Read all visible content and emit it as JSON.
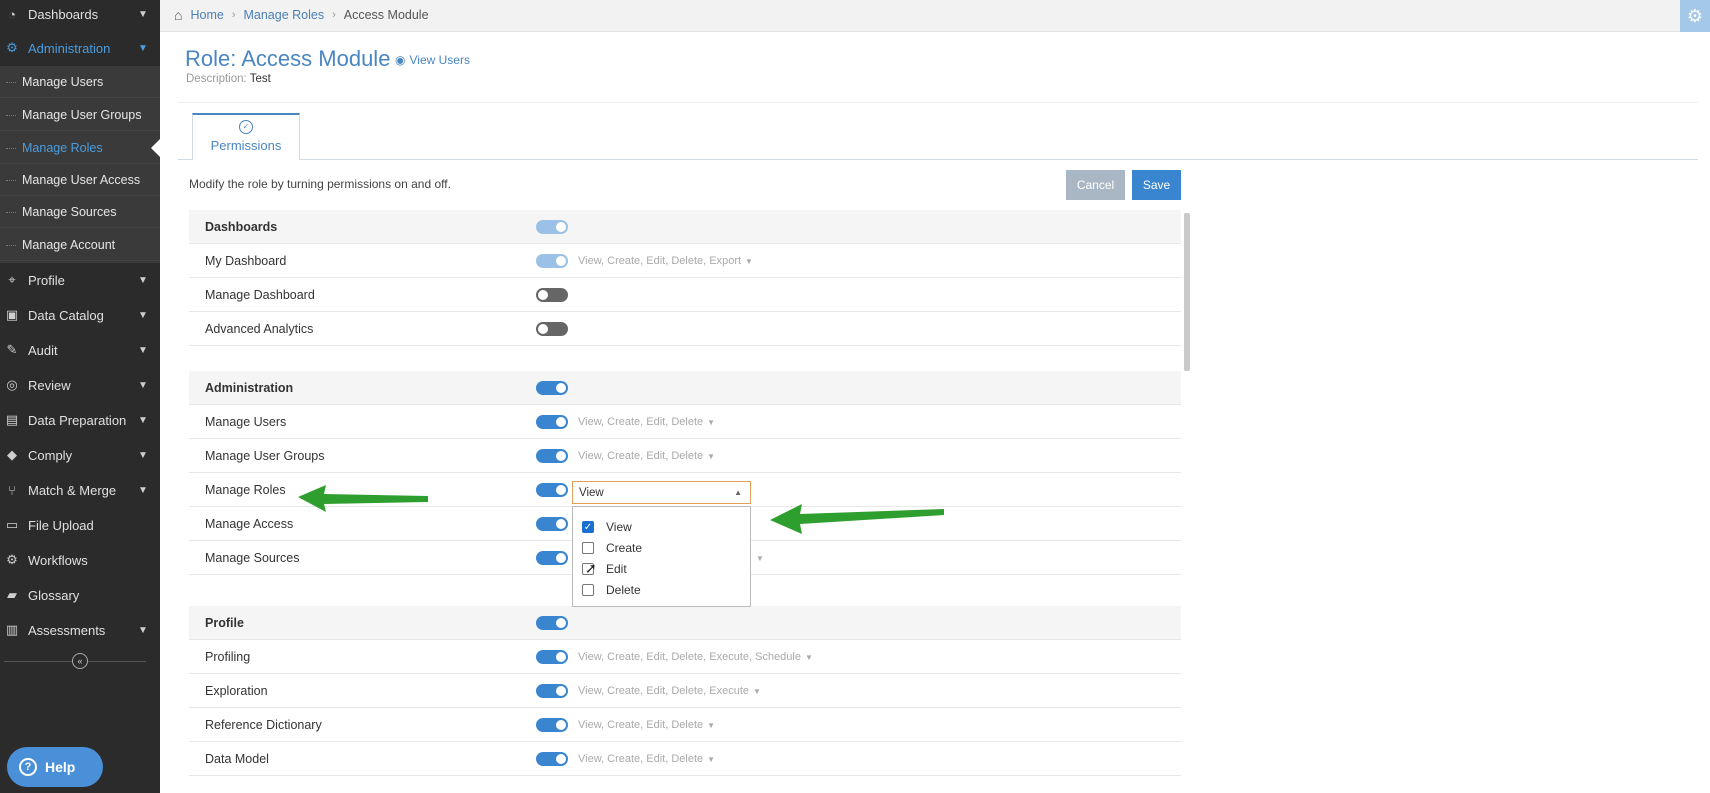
{
  "sidebar": {
    "items": [
      {
        "label": "Dashboards",
        "icon": "dashboard-icon",
        "has_chevron": true
      },
      {
        "label": "Administration",
        "icon": "gears-icon",
        "has_chevron": true,
        "active": true
      },
      {
        "label": "Profile",
        "icon": "crosshair-icon",
        "has_chevron": true
      },
      {
        "label": "Data Catalog",
        "icon": "catalog-icon",
        "has_chevron": true
      },
      {
        "label": "Audit",
        "icon": "edit-icon",
        "has_chevron": true
      },
      {
        "label": "Review",
        "icon": "compass-icon",
        "has_chevron": true
      },
      {
        "label": "Data Preparation",
        "icon": "preparation-icon",
        "has_chevron": true
      },
      {
        "label": "Comply",
        "icon": "tags-icon",
        "has_chevron": true
      },
      {
        "label": "Match & Merge",
        "icon": "merge-icon",
        "has_chevron": true
      },
      {
        "label": "File Upload",
        "icon": "upload-icon",
        "has_chevron": false
      },
      {
        "label": "Workflows",
        "icon": "workflow-icon",
        "has_chevron": false
      },
      {
        "label": "Glossary",
        "icon": "book-icon",
        "has_chevron": false
      },
      {
        "label": "Assessments",
        "icon": "clipboard-icon",
        "has_chevron": true
      }
    ],
    "sub_items": [
      {
        "label": "Manage Users"
      },
      {
        "label": "Manage User Groups"
      },
      {
        "label": "Manage Roles",
        "active": true
      },
      {
        "label": "Manage User Access"
      },
      {
        "label": "Manage Sources"
      },
      {
        "label": "Manage Account"
      }
    ],
    "help_label": "Help"
  },
  "breadcrumb": {
    "home": "Home",
    "section": "Manage Roles",
    "current": "Access Module"
  },
  "page": {
    "title": "Role: Access Module",
    "view_users": "View Users",
    "description_label": "Description:",
    "description_value": "Test",
    "tab_label": "Permissions",
    "instruction": "Modify the role by turning permissions on and off.",
    "cancel_label": "Cancel",
    "save_label": "Save"
  },
  "permissions": {
    "dashboards": {
      "header": "Dashboards",
      "rows": [
        {
          "label": "My Dashboard",
          "perms": "View, Create, Edit, Delete, Export"
        },
        {
          "label": "Manage Dashboard",
          "perms": ""
        },
        {
          "label": "Advanced Analytics",
          "perms": ""
        }
      ]
    },
    "administration": {
      "header": "Administration",
      "rows": [
        {
          "label": "Manage Users",
          "perms": "View, Create, Edit, Delete"
        },
        {
          "label": "Manage User Groups",
          "perms": "View, Create, Edit, Delete"
        },
        {
          "label": "Manage Roles",
          "perms": "View"
        },
        {
          "label": "Manage Access",
          "perms": ""
        },
        {
          "label": "Manage Sources",
          "perms": ""
        }
      ]
    },
    "profile": {
      "header": "Profile",
      "rows": [
        {
          "label": "Profiling",
          "perms": "View, Create, Edit, Delete, Execute, Schedule"
        },
        {
          "label": "Exploration",
          "perms": "View, Create, Edit, Delete, Execute"
        },
        {
          "label": "Reference Dictionary",
          "perms": "View, Create, Edit, Delete"
        },
        {
          "label": "Data Model",
          "perms": "View, Create, Edit, Delete"
        }
      ]
    }
  },
  "dropdown": {
    "selected": "View",
    "options": [
      {
        "label": "View",
        "checked": true
      },
      {
        "label": "Create",
        "checked": false
      },
      {
        "label": "Edit",
        "checked": false
      },
      {
        "label": "Delete",
        "checked": false
      }
    ]
  },
  "colors": {
    "accent": "#3a85d0",
    "annotation_arrow": "#2e9e2e",
    "sidebar_bg": "#2b2b2b"
  }
}
